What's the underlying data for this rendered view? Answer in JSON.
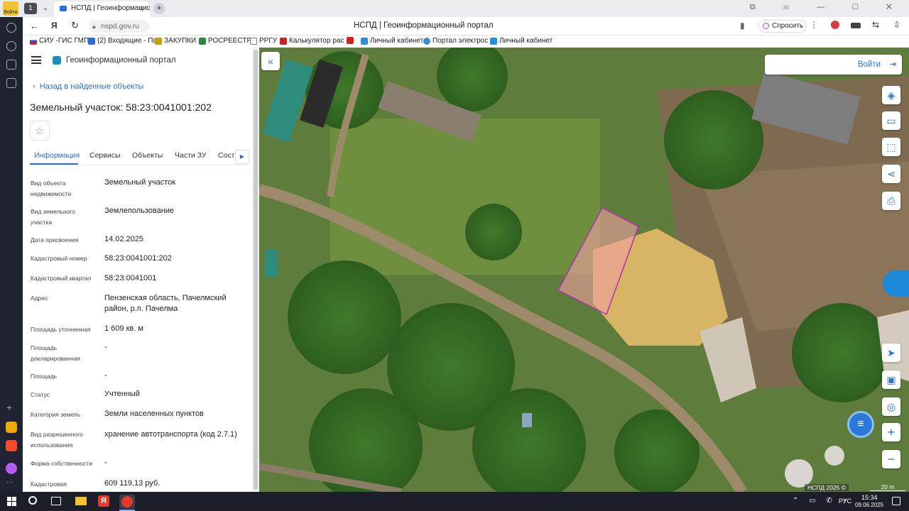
{
  "browser": {
    "tab_title": "НСПД | Геоинформационн",
    "url": "nspd.gov.ru",
    "page_title": "НСПД | Геоинформационный портал",
    "ask_label": "Спросить",
    "profile_label": "Войти",
    "tab_count": "1"
  },
  "bookmarks": [
    {
      "label": "СИУ -ГИС ГМП",
      "color": "#d33"
    },
    {
      "label": "(2) Входящие - По",
      "color": "#2a6fdb"
    },
    {
      "label": "ЗАКУПКИ",
      "color": "#c8a000"
    },
    {
      "label": "РОСРЕЕСТР",
      "color": "#2a8a3a"
    },
    {
      "label": "РРГУ",
      "color": "#777"
    },
    {
      "label": "Калькулятор рас",
      "color": "#c22"
    },
    {
      "label": "",
      "color": "#c22"
    },
    {
      "label": "Личный кабинет",
      "color": "#2a8fd8"
    },
    {
      "label": "Портал электрос",
      "color": "#3a8fd8"
    },
    {
      "label": "Личный кабинет",
      "color": "#2a8fd8"
    }
  ],
  "panel": {
    "app_title": "Геоинформационный портал",
    "back_link": "Назад в найденные объекты",
    "object_title": "Земельный участок: 58:23:0041001:202",
    "tabs": [
      "Информация",
      "Сервисы",
      "Объекты",
      "Части ЗУ",
      "Соста"
    ],
    "fields": [
      {
        "label": "Вид объекта недвижимости",
        "value": "Земельный участок"
      },
      {
        "label": "Вид земельного участка",
        "value": "Землепользование"
      },
      {
        "label": "Дата присвоения",
        "value": "14.02.2025"
      },
      {
        "label": "Кадастровый номер",
        "value": "58:23:0041001:202"
      },
      {
        "label": "Кадастровый квартал",
        "value": "58:23:0041001"
      },
      {
        "label": "Адрес",
        "value": "Пензенская область, Пачелмский район, р.п. Пачелма"
      },
      {
        "label": "Площадь уточненная",
        "value": "1 609 кв. м"
      },
      {
        "label": "Площадь декларированная",
        "value": "-"
      },
      {
        "label": "Площадь",
        "value": "-"
      },
      {
        "label": "Статус",
        "value": "Учтенный"
      },
      {
        "label": "Категория земель",
        "value": "Земли населенных пунктов"
      },
      {
        "label": "Вид разрешенного использования",
        "value": "хранение автотранспорта (код 2.7.1)"
      },
      {
        "label": "Форма собственности",
        "value": "-"
      },
      {
        "label": "Кадастровая",
        "value": "609 119,13 руб."
      }
    ]
  },
  "map": {
    "login_label": "Войти",
    "copyright": "НСПД 2025 ©",
    "scale": "20 m",
    "parcel_fill": "#f0a0a0",
    "parcel_stroke": "#b030b0"
  },
  "taskbar": {
    "lang": "РУС",
    "time": "15:34",
    "date": "09.06.2025"
  }
}
